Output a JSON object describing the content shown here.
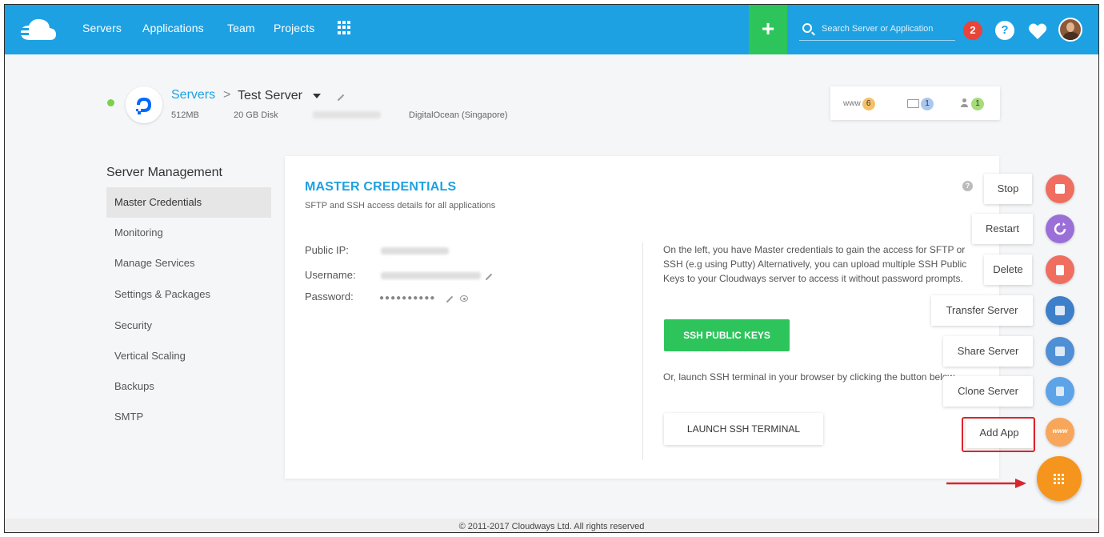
{
  "nav": {
    "items": [
      "Servers",
      "Applications",
      "Team",
      "Projects"
    ],
    "plus_label": "+",
    "search_placeholder": "Search Server or Application",
    "notification_count": "2",
    "help_label": "?"
  },
  "server": {
    "breadcrumb_root": "Servers",
    "breadcrumb_sep": ">",
    "name": "Test Server",
    "memory": "512MB",
    "disk": "20 GB Disk",
    "provider": "DigitalOcean (Singapore)",
    "stats": {
      "www_label": "www",
      "www_count": "6",
      "folder_count": "1",
      "users_count": "1"
    }
  },
  "sidebar": {
    "title": "Server Management",
    "items": [
      {
        "label": "Master Credentials",
        "active": true
      },
      {
        "label": "Monitoring"
      },
      {
        "label": "Manage Services"
      },
      {
        "label": "Settings & Packages"
      },
      {
        "label": "Security"
      },
      {
        "label": "Vertical Scaling"
      },
      {
        "label": "Backups"
      },
      {
        "label": "SMTP"
      }
    ]
  },
  "credentials": {
    "title": "MASTER CREDENTIALS",
    "subtitle": "SFTP and SSH access details for all applications",
    "public_ip_label": "Public IP:",
    "username_label": "Username:",
    "password_label": "Password:",
    "password_mask": "●●●●●●●●●●",
    "info_text": "On the left, you have Master credentials to gain the access for SFTP or SSH (e.g using Putty) Alternatively, you can upload multiple SSH Public Keys to your Cloudways server to access it without password prompts.",
    "ssh_keys_button": "SSH PUBLIC KEYS",
    "terminal_text": "Or, launch SSH terminal in your browser by clicking the button below.",
    "terminal_button": "LAUNCH SSH TERMINAL"
  },
  "actions": [
    {
      "label": "Stop",
      "color": "#f06e60",
      "icon": "stop-icon"
    },
    {
      "label": "Restart",
      "color": "#9b6fd8",
      "icon": "restart-icon"
    },
    {
      "label": "Delete",
      "color": "#f06e60",
      "icon": "delete-icon"
    },
    {
      "label": "Transfer Server",
      "color": "#3d7fc8",
      "icon": "transfer-icon"
    },
    {
      "label": "Share Server",
      "color": "#4e8fd6",
      "icon": "share-icon"
    },
    {
      "label": "Clone Server",
      "color": "#5da3e8",
      "icon": "clone-icon"
    },
    {
      "label": "Add App",
      "color": "#f7a65a",
      "icon": "www-icon",
      "icon_text": "www"
    }
  ],
  "footer": "© 2011-2017 Cloudways Ltd. All rights reserved",
  "colors": {
    "primary": "#1da1e2",
    "success": "#2ec45c",
    "fab": "#f5951d",
    "highlight": "#d9252c"
  }
}
